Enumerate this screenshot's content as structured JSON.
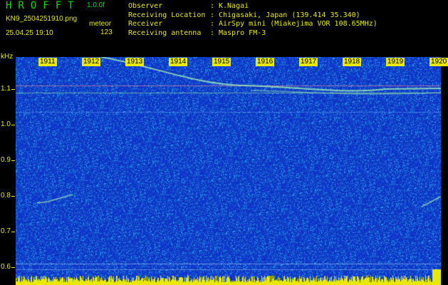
{
  "header": {
    "logo": "HROFFT",
    "version": "1.0.0f",
    "filename": "KN9_2504251910.png",
    "mode": "meteor",
    "datetime": "25.04.25 19:10",
    "count": "123",
    "fields": [
      {
        "key": "Observer",
        "value": "K.Nagai"
      },
      {
        "key": "Receiving Location",
        "value": "Chigasaki, Japan (139.414 35.340)"
      },
      {
        "key": "Receiver",
        "value": "AirSpy mini (Miakejima VOR 108.65MHz)"
      },
      {
        "key": "Receiving antenna",
        "value": "Maspro FM-3"
      }
    ]
  },
  "spectrogram": {
    "unit": "kHz",
    "y_ticks": [
      "1.1",
      "1.0",
      "0.9",
      "0.8",
      "0.7",
      "0.6"
    ],
    "x_ticks": [
      "1911",
      "1912",
      "1913",
      "1914",
      "1915",
      "1916",
      "1917",
      "1918",
      "1919",
      "1920"
    ],
    "colors": {
      "background": "#1030c0",
      "noise": "#20a0e0",
      "trace": "#a0ffa0",
      "label": "#e8e800"
    }
  }
}
